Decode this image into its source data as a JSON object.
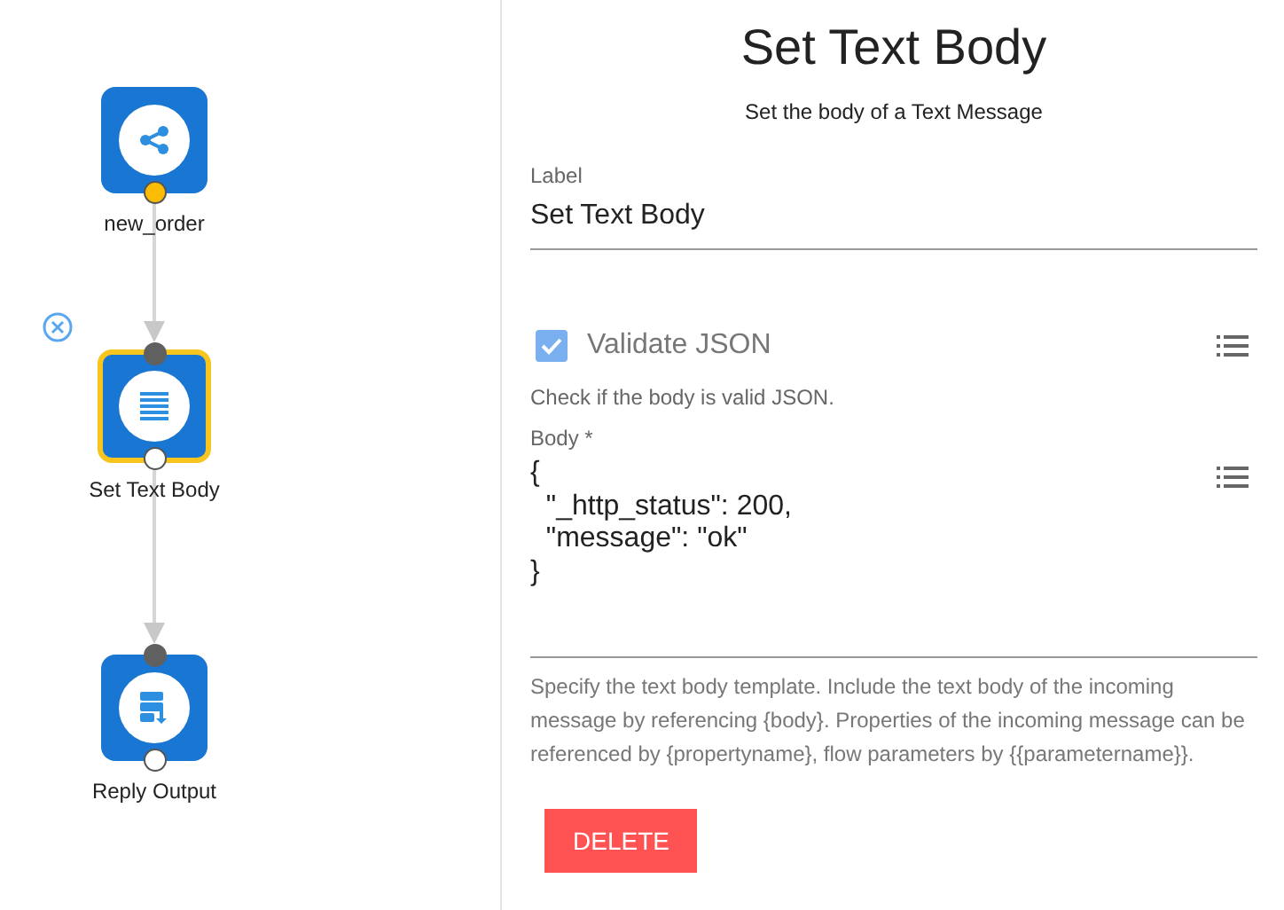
{
  "flow": {
    "nodes": [
      {
        "label": "new_order",
        "kind": "trigger",
        "selected": false,
        "input_port": false,
        "output_active": true
      },
      {
        "label": "Set Text Body",
        "kind": "transform",
        "selected": true,
        "input_port": true,
        "output_active": false
      },
      {
        "label": "Reply Output",
        "kind": "output",
        "selected": false,
        "input_port": true,
        "output_active": false
      }
    ]
  },
  "panel": {
    "title": "Set Text Body",
    "subtitle": "Set the body of a Text Message",
    "label_field": {
      "label": "Label",
      "value": "Set Text Body"
    },
    "validate": {
      "label": "Validate JSON",
      "checked": true,
      "help": "Check if the body is valid JSON."
    },
    "body_field": {
      "label": "Body *",
      "value": "{\n  \"_http_status\": 200,\n  \"message\": \"ok\"\n}",
      "help": "Specify the text body template. Include the text body of the incoming message by referencing {body}. Properties of the incoming message can be referenced by {propertyname}, flow parameters by {{parametername}}."
    },
    "delete_button": "DELETE"
  }
}
